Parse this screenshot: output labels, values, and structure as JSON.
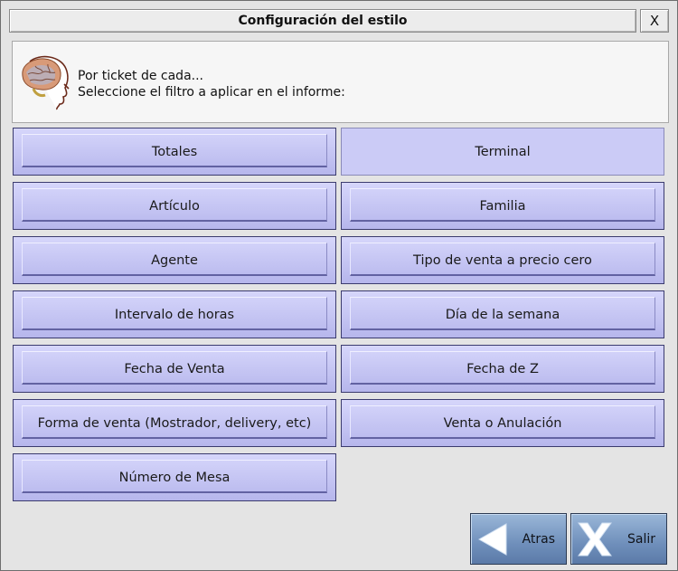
{
  "window": {
    "title": "Configuración del estilo",
    "close_label": "X"
  },
  "info": {
    "line1": "Por ticket de cada...",
    "line2": "Seleccione el filtro a aplicar en el informe:"
  },
  "options": [
    {
      "label": "Totales",
      "selected": false
    },
    {
      "label": "Terminal",
      "selected": true
    },
    {
      "label": "Artículo",
      "selected": false
    },
    {
      "label": "Familia",
      "selected": false
    },
    {
      "label": "Agente",
      "selected": false
    },
    {
      "label": "Tipo de venta a precio cero",
      "selected": false
    },
    {
      "label": "Intervalo de horas",
      "selected": false
    },
    {
      "label": "Día de la semana",
      "selected": false
    },
    {
      "label": "Fecha de Venta",
      "selected": false
    },
    {
      "label": "Fecha de Z",
      "selected": false
    },
    {
      "label": "Forma de venta (Mostrador, delivery, etc)",
      "selected": false
    },
    {
      "label": "Venta o Anulación",
      "selected": false
    },
    {
      "label": "Número de Mesa",
      "selected": false
    }
  ],
  "nav": {
    "back_label": "Atras",
    "back_icon": "left-arrow-icon",
    "exit_label": "Salir",
    "exit_icon": "x-icon"
  },
  "colors": {
    "option_bg": "#c6c6f4",
    "option_selected_bg": "#cbcbf6",
    "nav_bg": "#7f9fc7"
  }
}
